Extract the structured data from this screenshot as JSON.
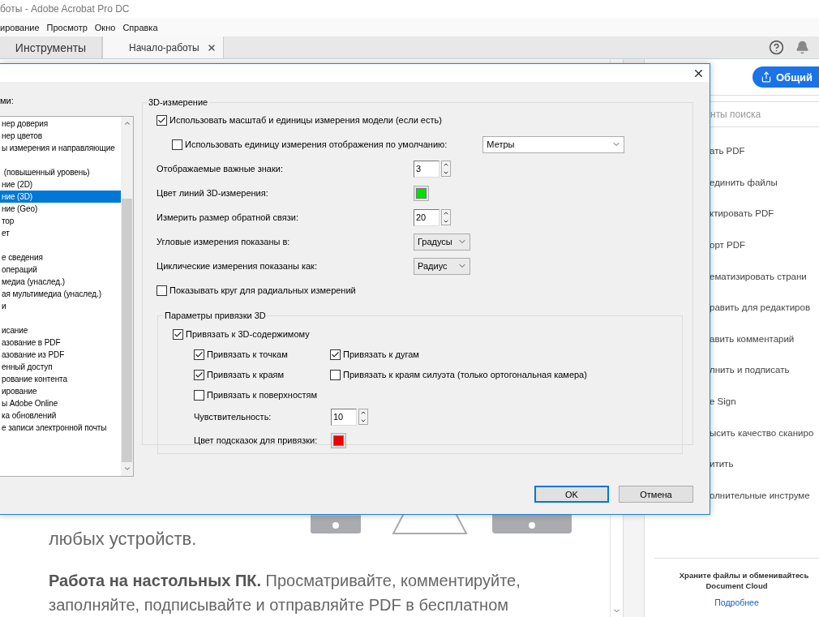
{
  "window": {
    "title": "боты - Adobe Acrobat Pro DC"
  },
  "menu": [
    "ирование",
    "Просмотр",
    "Окно",
    "Справка"
  ],
  "tabs": [
    {
      "label": "Инструменты",
      "selected": false,
      "closable": false
    },
    {
      "label": "Начало-работы",
      "selected": true,
      "closable": true
    }
  ],
  "share_button": "Общий",
  "tools_panel": {
    "search_placeholder": "нты поиска",
    "tools": [
      "ать PDF",
      "единить файлы",
      "ктировать PDF",
      "орт PDF",
      "ематизировать страни",
      "равить для редактиров",
      "авить комментарий",
      "лнить и подписать",
      "e Sign",
      "ысить качество сканиро",
      "итить",
      "олнительные инструме"
    ],
    "promo": {
      "lines": [
        "Храните файлы и обменивайтесь",
        "Document Cloud"
      ],
      "link": "Подробнее"
    }
  },
  "document": {
    "lines": [
      "любых устройств."
    ],
    "paragraph": "**Работа на настольных ПК.** Просматривайте, комментируйте, заполняйте, подписывайте и отправляйте PDF в бесплатном"
  },
  "dialog": {
    "categories_label": "ми:",
    "category_groups": [
      {
        "items": [
          {
            "label": "нер доверия",
            "selected": false
          },
          {
            "label": "нер цветов",
            "selected": false
          },
          {
            "label": "ы измерения и направляющие",
            "selected": false
          }
        ]
      },
      {
        "items": [
          {
            "label": " (повышенный уровень)",
            "selected": false
          },
          {
            "label": "ние (2D)",
            "selected": false
          },
          {
            "label": "ние (3D)",
            "selected": true
          },
          {
            "label": "ние (Geo)",
            "selected": false
          },
          {
            "label": "тор",
            "selected": false
          },
          {
            "label": "ет",
            "selected": false
          }
        ]
      },
      {
        "items": [
          {
            "label": "е сведения",
            "selected": false
          },
          {
            "label": "операций",
            "selected": false
          },
          {
            "label": "медиа (унаслед.)",
            "selected": false
          },
          {
            "label": "ая мультимедиа (унаслед.)",
            "selected": false
          },
          {
            "label": "и",
            "selected": false
          }
        ]
      },
      {
        "items": [
          {
            "label": "исание",
            "selected": false
          },
          {
            "label": "азование в PDF",
            "selected": false
          },
          {
            "label": "азование из PDF",
            "selected": false
          },
          {
            "label": "енный доступ",
            "selected": false
          },
          {
            "label": "рование контента",
            "selected": false
          },
          {
            "label": "ирование",
            "selected": false
          },
          {
            "label": "ы Adobe Online",
            "selected": false
          },
          {
            "label": "ка обновлений",
            "selected": false
          },
          {
            "label": "е записи электронной почты",
            "selected": false
          }
        ]
      }
    ],
    "group": {
      "title": "3D-измерение",
      "rows": [
        {
          "kind": "checkbox",
          "label": "Использовать масштаб и единицы измерения модели (если есть)",
          "checked": true
        },
        {
          "kind": "checkbox_select",
          "label": "Использовать единицу измерения отображения по умолчанию:",
          "checked": false,
          "value": "Метры"
        },
        {
          "kind": "spin",
          "label": "Отображаемые важные знаки:",
          "value": "3"
        },
        {
          "kind": "color",
          "label": "Цвет линий 3D-измерения:",
          "color": "#00e000"
        },
        {
          "kind": "spin",
          "label": "Измерить размер обратной связи:",
          "value": "20"
        },
        {
          "kind": "select",
          "label": "Угловые измерения показаны в:",
          "value": "Градусы"
        },
        {
          "kind": "select",
          "label": "Циклические измерения показаны как:",
          "value": "Радиус"
        },
        {
          "kind": "checkbox",
          "label": "Показывать круг для радиальных измерений",
          "checked": false
        }
      ],
      "snap": {
        "title": "Параметры привязки 3D",
        "master": {
          "label": "Привязать к 3D-содержимому",
          "checked": true
        },
        "options": [
          {
            "label": "Привязать к точкам",
            "checked": true
          },
          {
            "label": "Привязать к дугам",
            "checked": true
          },
          {
            "label": "Привязать к краям",
            "checked": true
          },
          {
            "label": "Привязать к краям силуэта (только ортогональная камера)",
            "checked": false
          },
          {
            "label": "Привязать к поверхностям",
            "checked": false
          }
        ],
        "rows": [
          {
            "kind": "spin",
            "label": "Чувствительность:",
            "value": "10"
          },
          {
            "kind": "color",
            "label": "Цвет подсказок для привязки:",
            "color": "#ee0000"
          }
        ]
      }
    },
    "buttons": [
      {
        "label": "OK",
        "default": true
      },
      {
        "label": "Отмена",
        "default": false
      }
    ]
  }
}
